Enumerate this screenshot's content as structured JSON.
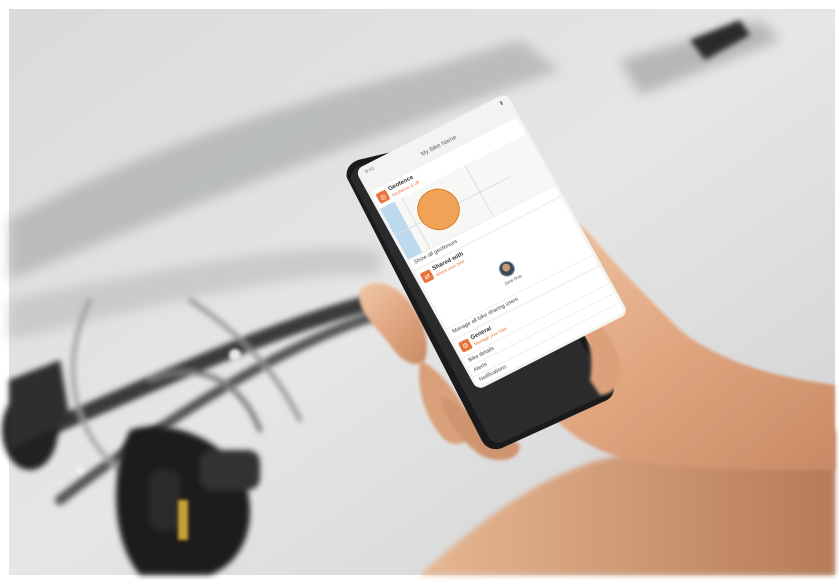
{
  "phone": {
    "status_time": "9:41",
    "app_title": "My Bike Name",
    "cards": {
      "geofence": {
        "title": "Geofence",
        "subtitle": "Geofence is off",
        "footer": "Show all geofences",
        "badge_icon": "geofence-icon"
      },
      "shared_with": {
        "title": "Shared with",
        "subtitle": "Share your bike",
        "friend_name": "Jane Doe",
        "footer": "Manage all bike sharing users",
        "badge_icon": "share-icon"
      },
      "general": {
        "title": "General",
        "subtitle": "Manage your bike",
        "rows": [
          "Bike details",
          "Alerts",
          "Notifications"
        ],
        "badge_icon": "gear-icon"
      }
    }
  },
  "colors": {
    "accent": "#e8743b",
    "geofence_fill": "#f0a257",
    "water": "#bcd9ee"
  }
}
